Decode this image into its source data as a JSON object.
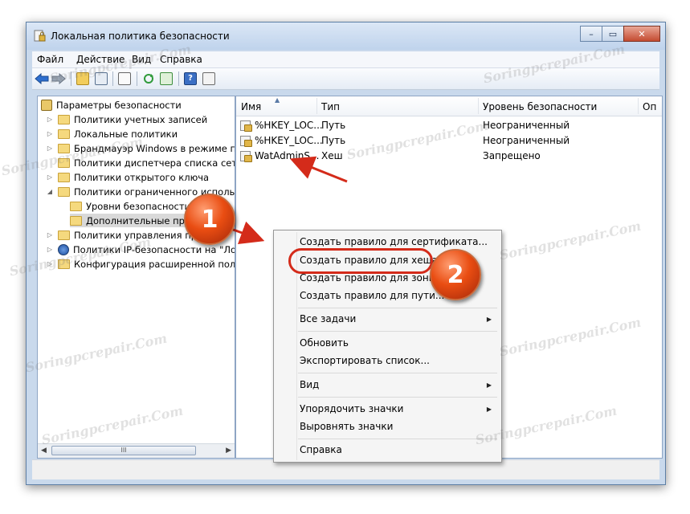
{
  "window": {
    "title": "Локальная политика безопасности",
    "controls": {
      "minimize": "–",
      "maximize": "▭",
      "close": "✕"
    }
  },
  "menu": [
    "Файл",
    "Действие",
    "Вид",
    "Справка"
  ],
  "tree": {
    "root": "Параметры безопасности",
    "items": [
      "Политики учетных записей",
      "Локальные политики",
      "Брандмауэр Windows в режиме пов",
      "Политики диспетчера списка сетей",
      "Политики открытого ключа",
      "Политики ограниченного использо",
      "Уровни безопасности",
      "Дополнительные прав",
      "Политики управления прил",
      "Политики IP-безопасности на \"Лока",
      "Конфигурация расширенной полит"
    ],
    "scroll_grip": "III"
  },
  "list": {
    "columns": [
      "Имя",
      "Тип",
      "Уровень безопасности",
      "Оп"
    ],
    "rows": [
      {
        "name": "%HKEY_LOC...",
        "type": "Путь",
        "level": "Неограниченный"
      },
      {
        "name": "%HKEY_LOC...",
        "type": "Путь",
        "level": "Неограниченный"
      },
      {
        "name": "WatAdminS...",
        "type": "Хеш",
        "level": "Запрещено"
      }
    ]
  },
  "context_menu": {
    "items": [
      "Создать правило для сертификата...",
      "Создать правило для хеша...",
      "Создать правило для зоны се",
      "Создать правило для пути...",
      "Все задачи",
      "Обновить",
      "Экспортировать список...",
      "Вид",
      "Упорядочить значки",
      "Выровнять значки",
      "Справка"
    ]
  },
  "annotations": {
    "badge1": "1",
    "badge2": "2",
    "accent": "#d42b1a"
  },
  "watermark": "Soringpcrepair.Com"
}
